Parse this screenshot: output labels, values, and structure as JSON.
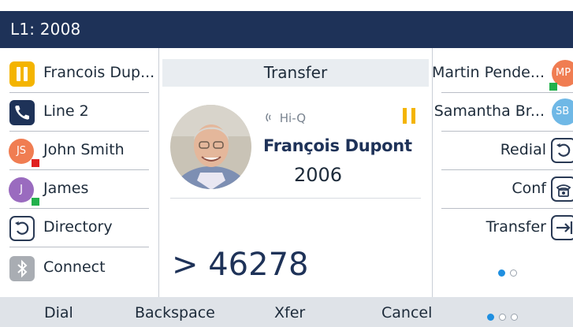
{
  "header": {
    "title": "L1: 2008"
  },
  "left_list": {
    "items": [
      {
        "label": "Francois Dup...",
        "icon": "hold-icon"
      },
      {
        "label": "Line 2",
        "icon": "phone-icon"
      },
      {
        "label": "John Smith",
        "icon": "avatar",
        "initials": "JS",
        "presence": "busy"
      },
      {
        "label": "James",
        "icon": "avatar",
        "initials": "J",
        "presence": "available"
      },
      {
        "label": "Directory",
        "icon": "directory-icon"
      },
      {
        "label": "Connect",
        "icon": "bluetooth-icon"
      }
    ]
  },
  "center": {
    "title": "Transfer",
    "hd_badge": "Hi-Q",
    "caller_name": "François Dupont",
    "caller_number": "2006",
    "dialed_prefix": ">",
    "dialed_number": "46278"
  },
  "right_list": {
    "items": [
      {
        "label": "Martin Pende...",
        "initials": "MP",
        "presence": "available"
      },
      {
        "label": "Samantha Br...",
        "initials": "SB",
        "presence": "none"
      },
      {
        "label": "Redial",
        "icon": "redial-icon"
      },
      {
        "label": "Conf",
        "icon": "conference-icon"
      },
      {
        "label": "Transfer",
        "icon": "transfer-icon"
      }
    ],
    "page_dots": {
      "total": 2,
      "active": 1
    }
  },
  "softkeys": {
    "items": [
      "Dial",
      "Backspace",
      "Xfer",
      "Cancel"
    ],
    "page_dots": {
      "total": 3,
      "active": 1
    }
  },
  "colors": {
    "header_bg": "#1e3258",
    "hold": "#f4b400",
    "presence_available": "#22b14c",
    "presence_busy": "#e02020",
    "accent": "#1f8fe0"
  }
}
